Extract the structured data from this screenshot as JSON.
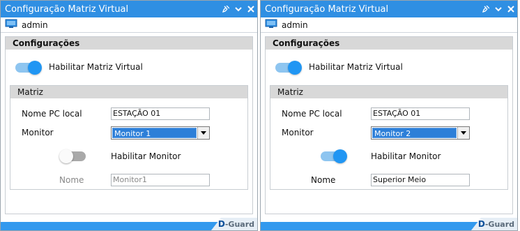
{
  "panels": [
    {
      "window_title": "Configuração Matriz Virtual",
      "user": "admin",
      "section_title": "Configurações",
      "enable_matrix_label": "Habilitar Matriz Virtual",
      "enable_matrix_on": true,
      "matriz_title": "Matriz",
      "pc_label": "Nome PC local",
      "pc_value": "ESTAÇÃO 01",
      "monitor_label": "Monitor",
      "monitor_selected": "Monitor 1",
      "enable_monitor_label": "Habilitar Monitor",
      "enable_monitor_on": false,
      "name_label": "Nome",
      "name_value": "Monitor1",
      "name_enabled": false,
      "logo_d": "D",
      "logo_guard": "-Guard"
    },
    {
      "window_title": "Configuração Matriz Virtual",
      "user": "admin",
      "section_title": "Configurações",
      "enable_matrix_label": "Habilitar Matriz Virtual",
      "enable_matrix_on": true,
      "matriz_title": "Matriz",
      "pc_label": "Nome PC local",
      "pc_value": "ESTAÇÃO 01",
      "monitor_label": "Monitor",
      "monitor_selected": "Monitor 2",
      "enable_monitor_label": "Habilitar Monitor",
      "enable_monitor_on": true,
      "name_label": "Nome",
      "name_value": "Superior Meio",
      "name_enabled": true,
      "logo_d": "D",
      "logo_guard": "-Guard"
    }
  ],
  "colors": {
    "titlebar": "#2f8fe3",
    "toggle_on": "#2196f3",
    "toggle_off": "#a9a9a9",
    "selection": "#2d7fd8",
    "footer": "#3399ee"
  },
  "icons": {
    "pin": "pin-icon",
    "collapse": "chevron-down-icon",
    "close": "close-icon",
    "user": "monitor-user-icon",
    "dropdown": "dropdown-arrow-icon"
  }
}
